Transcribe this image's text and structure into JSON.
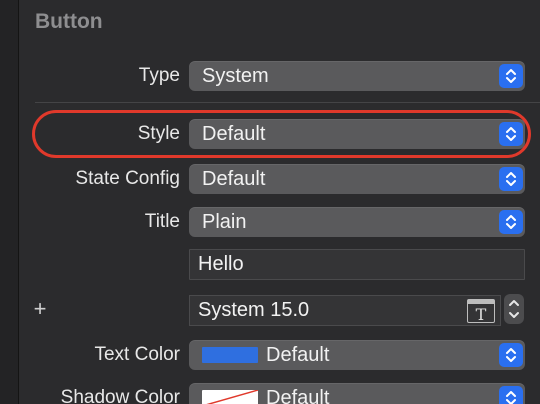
{
  "section": {
    "title": "Button"
  },
  "rows": {
    "type": {
      "label": "Type",
      "value": "System"
    },
    "style": {
      "label": "Style",
      "value": "Default"
    },
    "state_config": {
      "label": "State Config",
      "value": "Default"
    },
    "title": {
      "label": "Title",
      "value": "Plain"
    },
    "title_text": {
      "value": "Hello"
    },
    "font": {
      "add_symbol": "+",
      "value": "System 15.0",
      "icon": "font-picker-icon"
    },
    "text_color": {
      "label": "Text Color",
      "value": "Default",
      "swatch_color": "#2f6fe0"
    },
    "shadow_color": {
      "label": "Shadow Color",
      "value": "Default",
      "swatch_color": "#ffffff"
    }
  },
  "colors": {
    "accent": "#2a6ff0",
    "highlight": "#e0392b"
  }
}
